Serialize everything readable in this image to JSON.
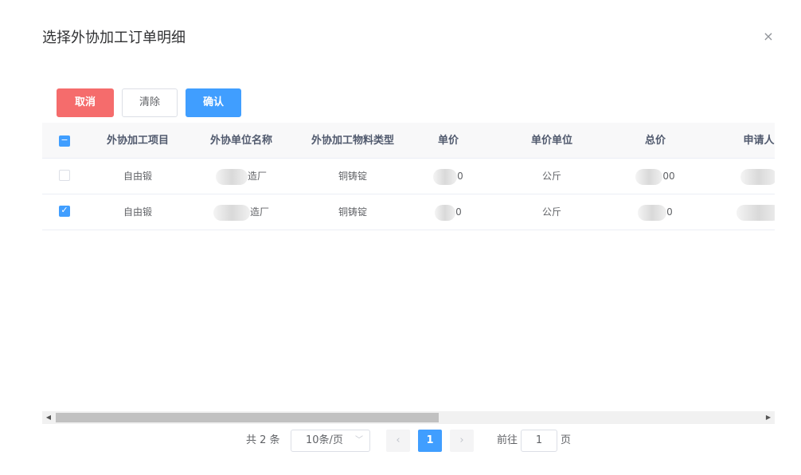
{
  "dialog": {
    "title": "选择外协加工订单明细",
    "close_glyph": "×"
  },
  "toolbar": {
    "cancel_label": "取消",
    "clear_label": "清除",
    "confirm_label": "确认"
  },
  "table": {
    "columns": [
      "外协加工项目",
      "外协单位名称",
      "外协加工物料类型",
      "单价",
      "单价单位",
      "总价",
      "申请人"
    ],
    "header_checkbox": "indeterminate",
    "rows": [
      {
        "checked": false,
        "item": "自由锻",
        "unit_name": "造厂",
        "material_type": "铜铸锭",
        "price": "0",
        "price_unit": "公斤",
        "total": "00",
        "applicant": ""
      },
      {
        "checked": true,
        "item": "自由锻",
        "unit_name": "造厂",
        "material_type": "铜铸锭",
        "price": "0",
        "price_unit": "公斤",
        "total": "0",
        "applicant": ""
      }
    ]
  },
  "pagination": {
    "total_text": "共 2 条",
    "page_size": "10条/页",
    "prev_glyph": "‹",
    "current_page": "1",
    "next_glyph": "›",
    "goto_label": "前往",
    "goto_value": "1",
    "page_suffix": "页"
  },
  "icons": {
    "close": "close-icon",
    "chevron_down": "chevron-down-icon",
    "check": "check-icon",
    "minus": "minus-icon"
  },
  "colors": {
    "primary": "#409eff",
    "danger": "#f56c6c",
    "header_bg": "#f8f8f9"
  }
}
